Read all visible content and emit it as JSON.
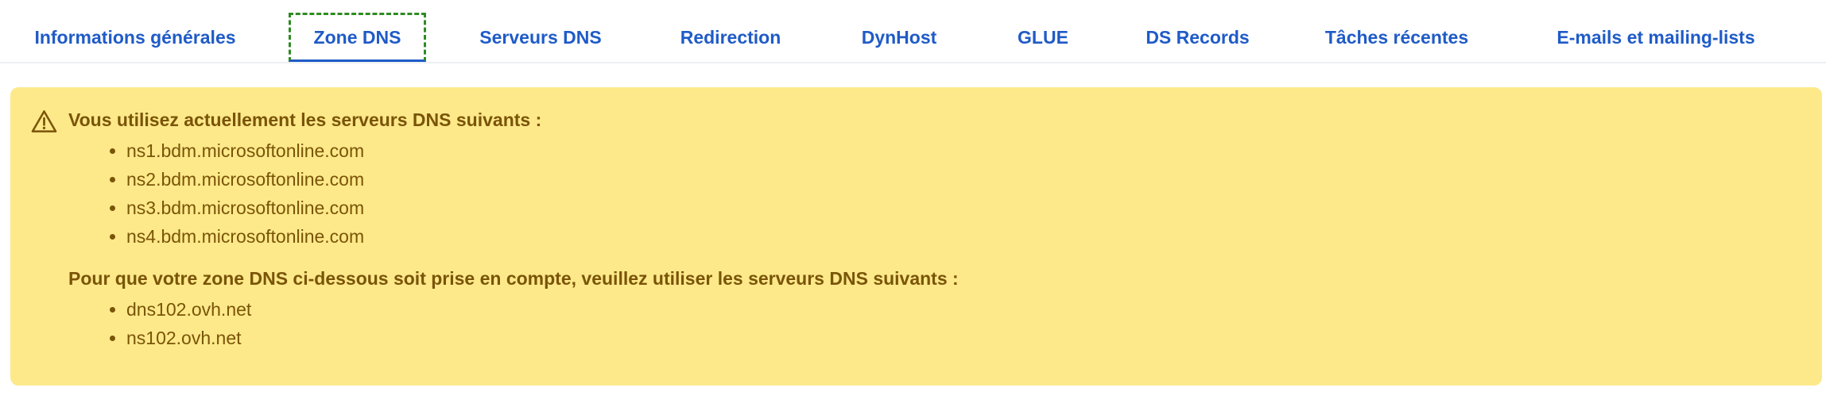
{
  "tabs": [
    {
      "label": "Informations générales"
    },
    {
      "label": "Zone DNS",
      "active": true
    },
    {
      "label": "Serveurs DNS"
    },
    {
      "label": "Redirection"
    },
    {
      "label": "DynHost"
    },
    {
      "label": "GLUE"
    },
    {
      "label": "DS Records"
    },
    {
      "label": "Tâches récentes"
    },
    {
      "label": "E-mails et mailing-lists"
    }
  ],
  "alert": {
    "icon": "warning-icon",
    "colors": {
      "background": "#fde98a",
      "text": "#7a5408"
    },
    "current_heading": "Vous utilisez actuellement les serveurs DNS suivants :",
    "current_servers": [
      "ns1.bdm.microsoftonline.com",
      "ns2.bdm.microsoftonline.com",
      "ns3.bdm.microsoftonline.com",
      "ns4.bdm.microsoftonline.com"
    ],
    "required_heading": "Pour que votre zone DNS ci-dessous soit prise en compte, veuillez utiliser les serveurs DNS suivants :",
    "required_servers": [
      "dns102.ovh.net",
      "ns102.ovh.net"
    ]
  },
  "accent_color": "#1f5bc7",
  "focus_color": "#2e8b22"
}
